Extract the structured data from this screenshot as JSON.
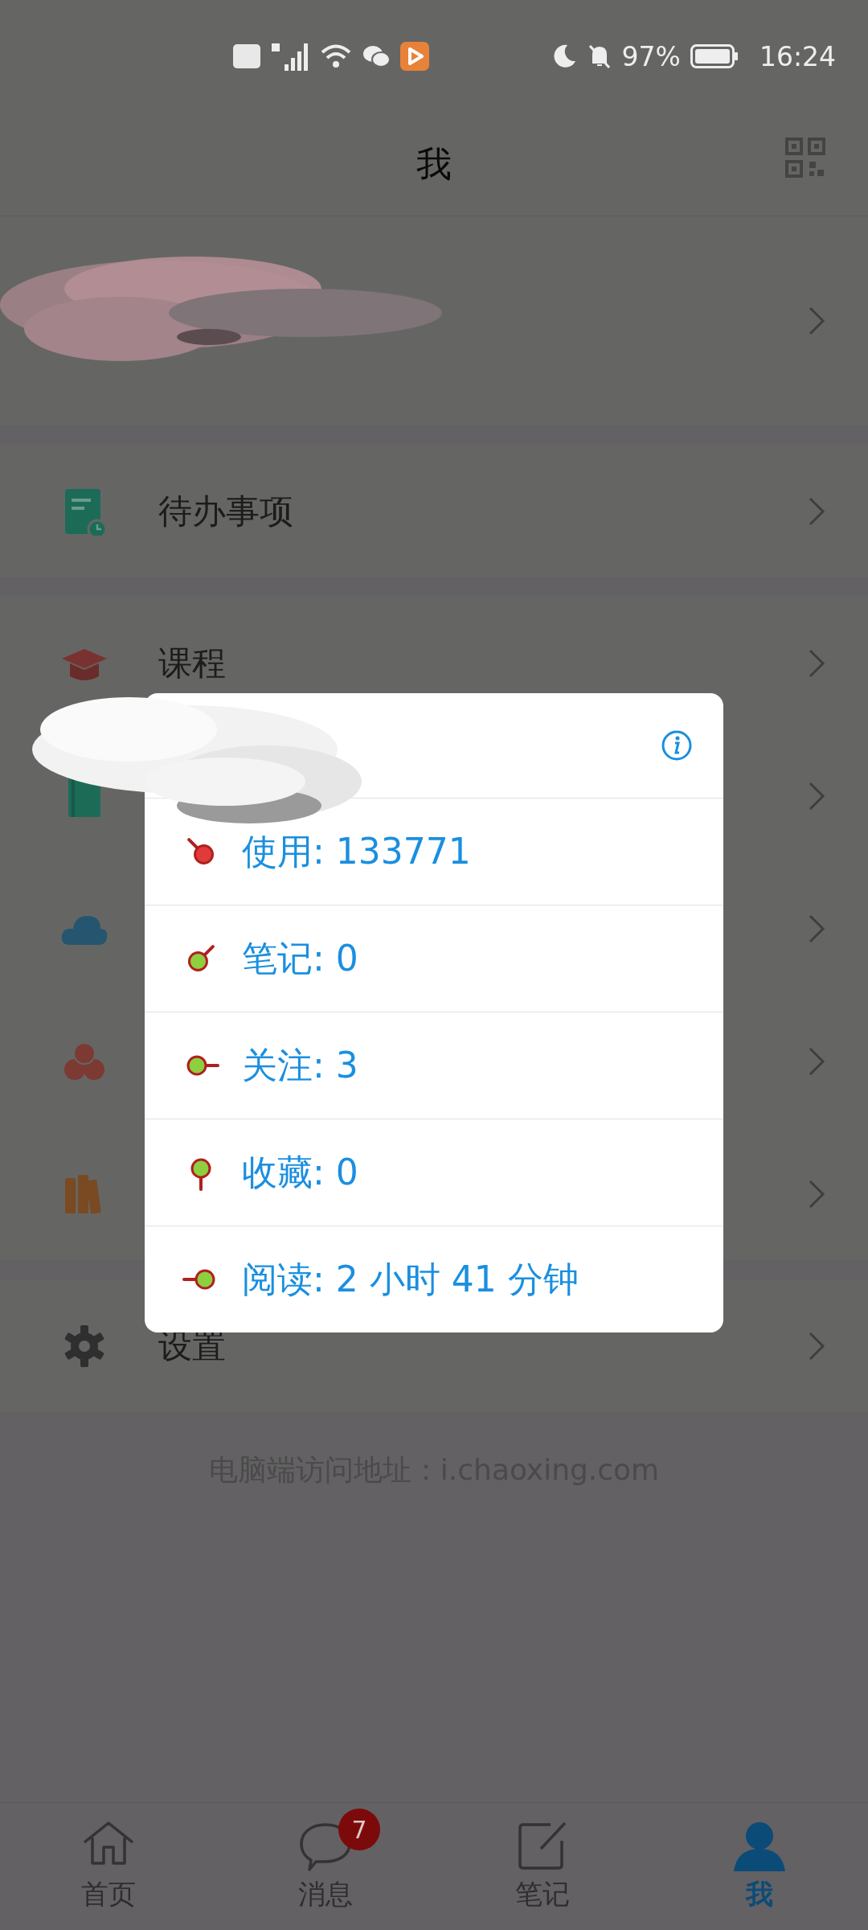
{
  "status_bar": {
    "battery": "97%",
    "time": "16:24"
  },
  "header": {
    "title": "我"
  },
  "menu_groups": [
    [
      {
        "kind": "todo",
        "label": "待办事项"
      }
    ],
    [
      {
        "kind": "course",
        "label": "课程"
      },
      {
        "kind": "notebook"
      },
      {
        "kind": "cloud"
      },
      {
        "kind": "group"
      },
      {
        "kind": "books"
      }
    ],
    [
      {
        "kind": "settings",
        "label": "设置"
      }
    ]
  ],
  "footer_note": "电脑端访问地址：i.chaoxing.com",
  "stats_popup": {
    "items": [
      {
        "kind": "usage",
        "text": "使用: 133771"
      },
      {
        "kind": "notes",
        "text": "笔记: 0"
      },
      {
        "kind": "follow",
        "text": "关注: 3"
      },
      {
        "kind": "favorites",
        "text": "收藏: 0"
      },
      {
        "kind": "reading",
        "text": "阅读: 2 小时 41 分钟"
      }
    ]
  },
  "tab_bar": [
    {
      "kind": "home",
      "label": "首页",
      "selected": false
    },
    {
      "kind": "message",
      "label": "消息",
      "badge": "7",
      "selected": false
    },
    {
      "kind": "note",
      "label": "笔记",
      "selected": false
    },
    {
      "kind": "me",
      "label": "我",
      "selected": true
    }
  ]
}
